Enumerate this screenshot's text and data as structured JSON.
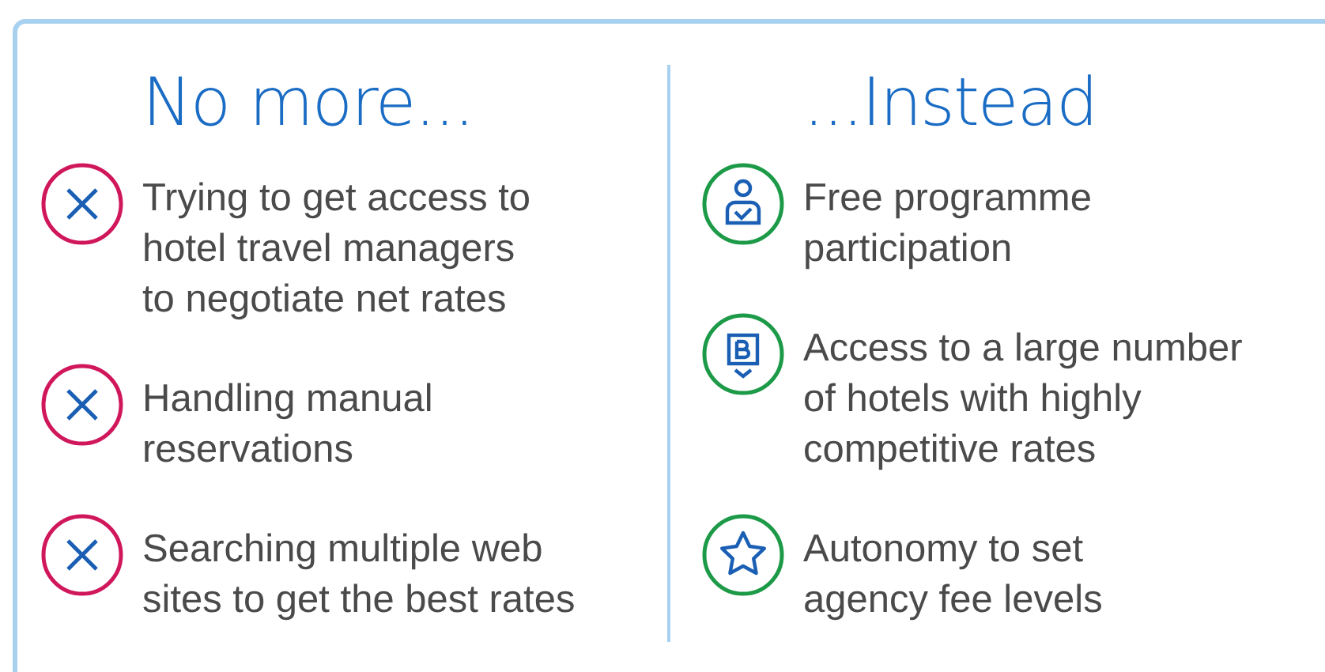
{
  "columns": [
    {
      "kind": "negative",
      "heading": "No more...",
      "items": [
        {
          "kind": "cross",
          "text": "Trying to get access to\nhotel travel managers\nto negotiate net rates"
        },
        {
          "kind": "cross",
          "text": "Handling manual\nreservations"
        },
        {
          "kind": "cross",
          "text": "Searching multiple web\nsites to get the best rates"
        }
      ]
    },
    {
      "kind": "positive",
      "heading": "...Instead",
      "items": [
        {
          "kind": "person",
          "text": "Free programme\nparticipation"
        },
        {
          "kind": "booking",
          "text": "Access to a large number\nof hotels with highly\ncompetitive rates"
        },
        {
          "kind": "star",
          "text": "Autonomy to set\nagency fee levels"
        }
      ]
    }
  ]
}
